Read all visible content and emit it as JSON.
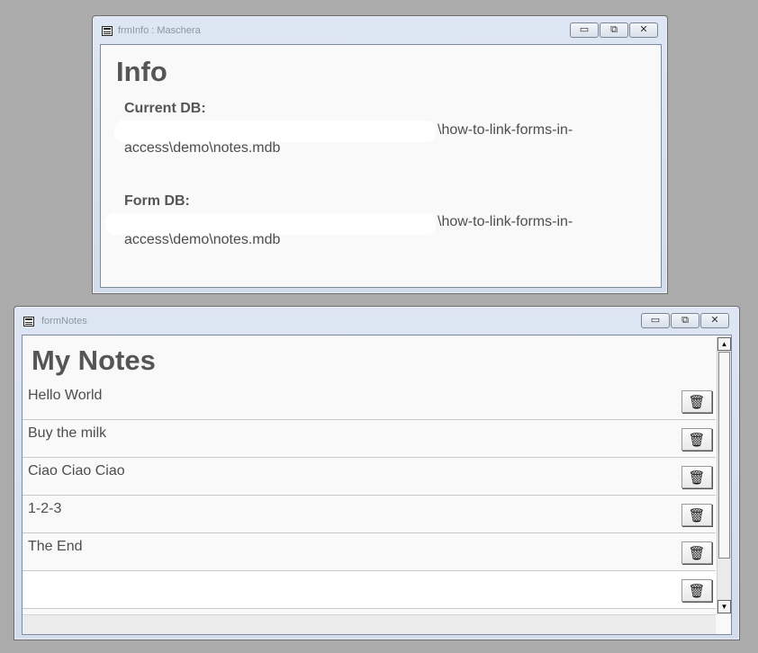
{
  "info_window": {
    "title": "frmInfo : Maschera",
    "heading": "Info",
    "current_db_label": "Current DB:",
    "current_db_path_line1": "\\how-to-link-forms-in-",
    "current_db_path_line2": "access\\demo\\notes.mdb",
    "form_db_label": "Form DB:",
    "form_db_path_line1": "\\how-to-link-forms-in-",
    "form_db_path_line2": "access\\demo\\notes.mdb"
  },
  "notes_window": {
    "title": "formNotes",
    "heading": "My Notes",
    "notes": [
      {
        "text": "Hello World",
        "delete_icon": "trash-icon"
      },
      {
        "text": "Buy the milk",
        "delete_icon": "trash-icon"
      },
      {
        "text": "Ciao Ciao Ciao",
        "delete_icon": "trash-icon"
      },
      {
        "text": "1-2-3",
        "delete_icon": "trash-icon"
      },
      {
        "text": "The End",
        "delete_icon": "trash-icon"
      },
      {
        "text": "",
        "delete_icon": "trash-icon"
      }
    ]
  },
  "window_controls": {
    "minimize_glyph": "▭",
    "restore_glyph": "⧉",
    "close_glyph": "✕"
  },
  "colors": {
    "background": "#ababab",
    "client": "#f9f9f9",
    "heading": "#555555"
  }
}
